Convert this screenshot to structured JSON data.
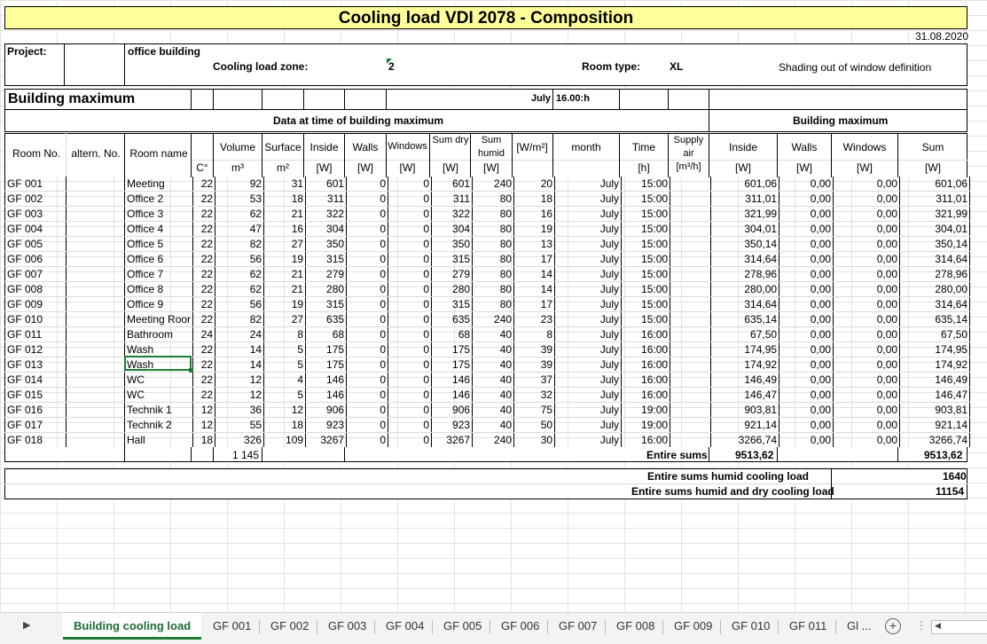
{
  "title": "Cooling load VDI 2078 - Composition",
  "date": "31.08.2020",
  "project_label": "Project:",
  "project_value": "office building",
  "zone_label": "Cooling load zone:",
  "zone_value": "2",
  "room_type_label": "Room type:",
  "room_type_value": "XL",
  "shading_note": "Shading out of window definition",
  "building_maximum_label": "Building maximum",
  "max_month": "July",
  "max_time": "16.00:h",
  "section_left": "Data at time of building maximum",
  "section_right": "Building maximum",
  "headers": {
    "room_no": "Room No.",
    "altern_no": "altern. No.",
    "room_name": "Room name",
    "temp_unit": "C°",
    "volume": "Volume",
    "volume_unit": "m³",
    "surface": "Surface",
    "surface_unit": "m²",
    "inside": "Inside",
    "inside_unit": "[W]",
    "walls": "Walls",
    "walls_unit": "[W]",
    "windows": "Windows",
    "windows_unit": "[W]",
    "sum_dry": "Sum dry",
    "sum_dry_unit": "[W]",
    "sum_humid": "Sum humid",
    "sum_humid_unit": "[W]",
    "wm2": "[W/m²]",
    "month": "month",
    "time": "Time",
    "time_unit": "[h]",
    "supply_air": "Supply air",
    "supply_air_unit": "[m³/h]",
    "bm_inside": "Inside",
    "bm_inside_unit": "[W]",
    "bm_walls": "Walls",
    "bm_walls_unit": "[W]",
    "bm_windows": "Windows",
    "bm_windows_unit": "[W]",
    "bm_sum": "Sum",
    "bm_sum_unit": "[W]"
  },
  "rows": [
    [
      "GF 001",
      "",
      "Meeting",
      "22",
      "92",
      "31",
      "601",
      "0",
      "0",
      "601",
      "240",
      "20",
      "July",
      "15:00",
      "",
      "601,06",
      "0,00",
      "0,00",
      "601,06"
    ],
    [
      "GF 002",
      "",
      "Office 2",
      "22",
      "53",
      "18",
      "311",
      "0",
      "0",
      "311",
      "80",
      "18",
      "July",
      "15:00",
      "",
      "311,01",
      "0,00",
      "0,00",
      "311,01"
    ],
    [
      "GF 003",
      "",
      "Office 3",
      "22",
      "62",
      "21",
      "322",
      "0",
      "0",
      "322",
      "80",
      "16",
      "July",
      "15:00",
      "",
      "321,99",
      "0,00",
      "0,00",
      "321,99"
    ],
    [
      "GF 004",
      "",
      "Office 4",
      "22",
      "47",
      "16",
      "304",
      "0",
      "0",
      "304",
      "80",
      "19",
      "July",
      "15:00",
      "",
      "304,01",
      "0,00",
      "0,00",
      "304,01"
    ],
    [
      "GF 005",
      "",
      "Office 5",
      "22",
      "82",
      "27",
      "350",
      "0",
      "0",
      "350",
      "80",
      "13",
      "July",
      "15:00",
      "",
      "350,14",
      "0,00",
      "0,00",
      "350,14"
    ],
    [
      "GF 006",
      "",
      "Office 6",
      "22",
      "56",
      "19",
      "315",
      "0",
      "0",
      "315",
      "80",
      "17",
      "July",
      "15:00",
      "",
      "314,64",
      "0,00",
      "0,00",
      "314,64"
    ],
    [
      "GF 007",
      "",
      "Office 7",
      "22",
      "62",
      "21",
      "279",
      "0",
      "0",
      "279",
      "80",
      "14",
      "July",
      "15:00",
      "",
      "278,96",
      "0,00",
      "0,00",
      "278,96"
    ],
    [
      "GF 008",
      "",
      "Office 8",
      "22",
      "62",
      "21",
      "280",
      "0",
      "0",
      "280",
      "80",
      "14",
      "July",
      "15:00",
      "",
      "280,00",
      "0,00",
      "0,00",
      "280,00"
    ],
    [
      "GF 009",
      "",
      "Office 9",
      "22",
      "56",
      "19",
      "315",
      "0",
      "0",
      "315",
      "80",
      "17",
      "July",
      "15:00",
      "",
      "314,64",
      "0,00",
      "0,00",
      "314,64"
    ],
    [
      "GF 010",
      "",
      "Meeting Roor",
      "22",
      "82",
      "27",
      "635",
      "0",
      "0",
      "635",
      "240",
      "23",
      "July",
      "15:00",
      "",
      "635,14",
      "0,00",
      "0,00",
      "635,14"
    ],
    [
      "GF 011",
      "",
      "Bathroom",
      "24",
      "24",
      "8",
      "68",
      "0",
      "0",
      "68",
      "40",
      "8",
      "July",
      "16:00",
      "",
      "67,50",
      "0,00",
      "0,00",
      "67,50"
    ],
    [
      "GF 012",
      "",
      "Wash",
      "22",
      "14",
      "5",
      "175",
      "0",
      "0",
      "175",
      "40",
      "39",
      "July",
      "16:00",
      "",
      "174,95",
      "0,00",
      "0,00",
      "174,95"
    ],
    [
      "GF 013",
      "",
      "Wash",
      "22",
      "14",
      "5",
      "175",
      "0",
      "0",
      "175",
      "40",
      "39",
      "July",
      "16:00",
      "",
      "174,92",
      "0,00",
      "0,00",
      "174,92"
    ],
    [
      "GF 014",
      "",
      "WC",
      "22",
      "12",
      "4",
      "146",
      "0",
      "0",
      "146",
      "40",
      "37",
      "July",
      "16:00",
      "",
      "146,49",
      "0,00",
      "0,00",
      "146,49"
    ],
    [
      "GF 015",
      "",
      "WC",
      "22",
      "12",
      "5",
      "146",
      "0",
      "0",
      "146",
      "40",
      "32",
      "July",
      "16:00",
      "",
      "146,47",
      "0,00",
      "0,00",
      "146,47"
    ],
    [
      "GF 016",
      "",
      "Technik 1",
      "12",
      "36",
      "12",
      "906",
      "0",
      "0",
      "906",
      "40",
      "75",
      "July",
      "19:00",
      "",
      "903,81",
      "0,00",
      "0,00",
      "903,81"
    ],
    [
      "GF 017",
      "",
      "Technik 2",
      "12",
      "55",
      "18",
      "923",
      "0",
      "0",
      "923",
      "40",
      "50",
      "July",
      "19:00",
      "",
      "921,14",
      "0,00",
      "0,00",
      "921,14"
    ],
    [
      "GF 018",
      "",
      "Hall",
      "18",
      "326",
      "109",
      "3267",
      "0",
      "0",
      "3267",
      "240",
      "30",
      "July",
      "16:00",
      "",
      "3266,74",
      "0,00",
      "0,00",
      "3266,74"
    ]
  ],
  "totals": {
    "volume": "1 145",
    "entire_sums_label": "Entire sums",
    "entire_sums_inside": "9513,62",
    "entire_sums_sum": "9513,62",
    "humid_label": "Entire sums humid cooling load",
    "humid_value": "1640",
    "humid_dry_label": "Entire sums humid and dry cooling load",
    "humid_dry_value": "11154"
  },
  "tabs": [
    "Building cooling load",
    "GF 001",
    "GF 002",
    "GF 003",
    "GF 004",
    "GF 005",
    "GF 006",
    "GF 007",
    "GF 008",
    "GF 009",
    "GF 010",
    "GF 011",
    "Gl ..."
  ],
  "active_tab": "Building cooling load"
}
